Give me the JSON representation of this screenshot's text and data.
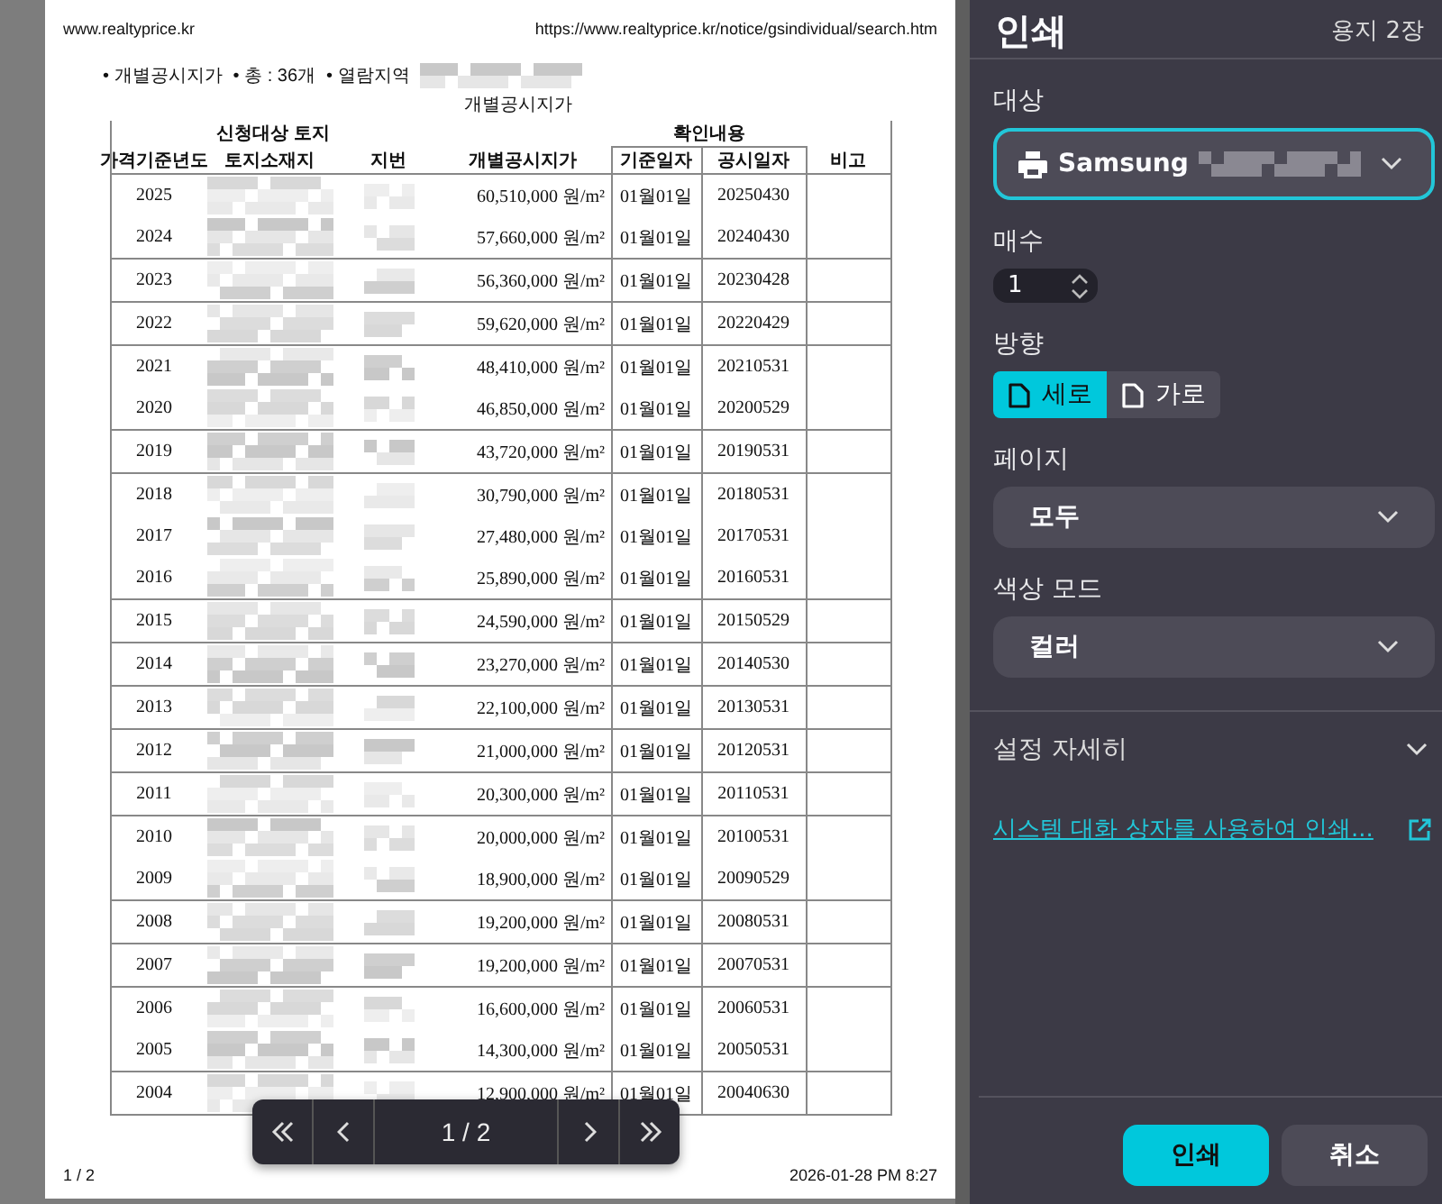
{
  "page": {
    "header_left": "www.realtyprice.kr",
    "header_right": "https://www.realtyprice.kr/notice/gsindividual/search.htm",
    "summary": [
      "• 개별공시지가",
      "• 총 : 36개",
      "• 열람지역"
    ],
    "table_title": "개별공시지가",
    "header_groups": [
      "신청대상 토지",
      "확인내용"
    ],
    "columns": [
      "가격기준년도",
      "토지소재지",
      "지번",
      "개별공시지가",
      "기준일자",
      "공시일자",
      "비고"
    ],
    "row_groups": [
      [
        {
          "year": "2025",
          "price": "60,510,000 원/m²",
          "base_date": "01월01일",
          "notice_date": "20250430"
        },
        {
          "year": "2024",
          "price": "57,660,000 원/m²",
          "base_date": "01월01일",
          "notice_date": "20240430"
        }
      ],
      [
        {
          "year": "2023",
          "price": "56,360,000 원/m²",
          "base_date": "01월01일",
          "notice_date": "20230428"
        }
      ],
      [
        {
          "year": "2022",
          "price": "59,620,000 원/m²",
          "base_date": "01월01일",
          "notice_date": "20220429"
        }
      ],
      [
        {
          "year": "2021",
          "price": "48,410,000 원/m²",
          "base_date": "01월01일",
          "notice_date": "20210531"
        },
        {
          "year": "2020",
          "price": "46,850,000 원/m²",
          "base_date": "01월01일",
          "notice_date": "20200529"
        }
      ],
      [
        {
          "year": "2019",
          "price": "43,720,000 원/m²",
          "base_date": "01월01일",
          "notice_date": "20190531"
        }
      ],
      [
        {
          "year": "2018",
          "price": "30,790,000 원/m²",
          "base_date": "01월01일",
          "notice_date": "20180531"
        },
        {
          "year": "2017",
          "price": "27,480,000 원/m²",
          "base_date": "01월01일",
          "notice_date": "20170531"
        },
        {
          "year": "2016",
          "price": "25,890,000 원/m²",
          "base_date": "01월01일",
          "notice_date": "20160531"
        }
      ],
      [
        {
          "year": "2015",
          "price": "24,590,000 원/m²",
          "base_date": "01월01일",
          "notice_date": "20150529"
        }
      ],
      [
        {
          "year": "2014",
          "price": "23,270,000 원/m²",
          "base_date": "01월01일",
          "notice_date": "20140530"
        }
      ],
      [
        {
          "year": "2013",
          "price": "22,100,000 원/m²",
          "base_date": "01월01일",
          "notice_date": "20130531"
        }
      ],
      [
        {
          "year": "2012",
          "price": "21,000,000 원/m²",
          "base_date": "01월01일",
          "notice_date": "20120531"
        }
      ],
      [
        {
          "year": "2011",
          "price": "20,300,000 원/m²",
          "base_date": "01월01일",
          "notice_date": "20110531"
        }
      ],
      [
        {
          "year": "2010",
          "price": "20,000,000 원/m²",
          "base_date": "01월01일",
          "notice_date": "20100531"
        },
        {
          "year": "2009",
          "price": "18,900,000 원/m²",
          "base_date": "01월01일",
          "notice_date": "20090529"
        }
      ],
      [
        {
          "year": "2008",
          "price": "19,200,000 원/m²",
          "base_date": "01월01일",
          "notice_date": "20080531"
        }
      ],
      [
        {
          "year": "2007",
          "price": "19,200,000 원/m²",
          "base_date": "01월01일",
          "notice_date": "20070531"
        }
      ],
      [
        {
          "year": "2006",
          "price": "16,600,000 원/m²",
          "base_date": "01월01일",
          "notice_date": "20060531"
        },
        {
          "year": "2005",
          "price": "14,300,000 원/m²",
          "base_date": "01월01일",
          "notice_date": "20050531"
        }
      ],
      [
        {
          "year": "2004",
          "price": "12,900,000 원/m²",
          "base_date": "01월01일",
          "notice_date": "20040630"
        }
      ]
    ],
    "footer_left": "1 / 2",
    "footer_right": "2026-01-28 PM 8:27"
  },
  "pager": {
    "page": "1 / 2"
  },
  "print_panel": {
    "title": "인쇄",
    "sheets": "용지 2장",
    "destination": {
      "label": "대상",
      "value": "Samsung"
    },
    "copies": {
      "label": "매수",
      "value": "1"
    },
    "orientation": {
      "label": "방향",
      "options": [
        {
          "label": "세로",
          "selected": true
        },
        {
          "label": "가로",
          "selected": false
        }
      ]
    },
    "pages": {
      "label": "페이지",
      "value": "모두"
    },
    "color_mode": {
      "label": "색상 모드",
      "value": "컬러"
    },
    "more_settings": {
      "label": "설정 자세히",
      "expanded": false
    },
    "system_dialog_link": "시스템 대화 상자를 사용하여 인쇄...",
    "buttons": [
      {
        "label": "인쇄",
        "kind": "primary"
      },
      {
        "label": "취소",
        "kind": "secondary"
      }
    ]
  }
}
